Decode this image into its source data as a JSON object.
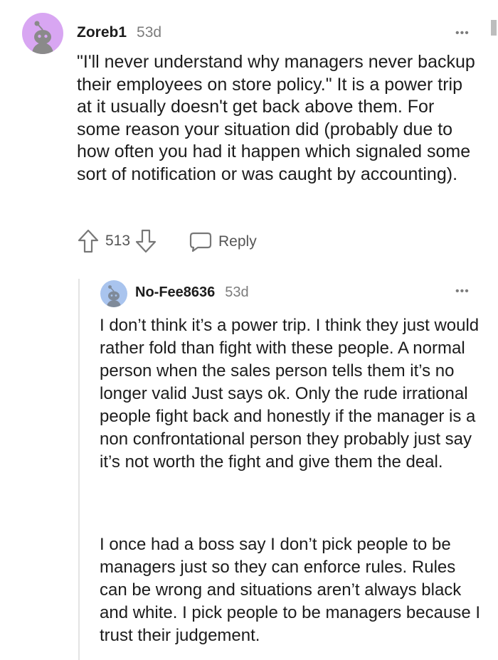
{
  "comments": [
    {
      "username": "Zoreb1",
      "age": "53d",
      "body": [
        "\"I'll never understand why managers never backup their employees on store policy.\" It is a power trip at it usually doesn't get back above them. For some reason your situation did (probably due to how often you had it happen which signaled some sort of notification or was caught by accounting)."
      ],
      "score": "513",
      "reply_label": "Reply",
      "avatar_color": "#d8a6f2"
    },
    {
      "username": "No-Fee8636",
      "age": "53d",
      "body": [
        "I don’t think it’s a power trip. I think they just would rather fold than fight with these people. A normal person when the sales person tells them it’s no longer valid Just says ok. Only the rude irrational people fight back and honestly if the manager is a non confrontational person they probably just say it’s not worth the fight and give them the deal.",
        "I once had a boss say I don’t pick people to be managers just so they can enforce rules. Rules can be wrong and situations aren’t always black and white. I pick people to be managers because I trust their judgement."
      ],
      "avatar_color": "#a9c4ee"
    }
  ],
  "icons": {
    "upvote": "upvote-arrow-icon",
    "downvote": "downvote-arrow-icon",
    "reply": "speech-bubble-icon",
    "more": "more-options-icon"
  },
  "more_glyph": "•••"
}
